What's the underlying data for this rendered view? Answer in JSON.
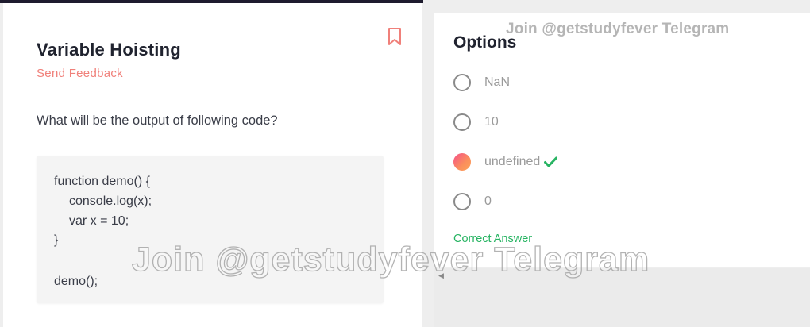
{
  "question": {
    "title": "Variable Hoisting",
    "feedback_label": "Send Feedback",
    "bookmark_icon": "bookmark-icon",
    "text": "What will be the output of following code?",
    "code_lines": [
      "function demo() {",
      "console.log(x);",
      "var x = 10;",
      "}",
      "demo();"
    ]
  },
  "options_panel": {
    "title": "Options",
    "options": [
      {
        "label": "NaN",
        "selected": false
      },
      {
        "label": "10",
        "selected": false
      },
      {
        "label": "undefined",
        "selected": true,
        "correct": true
      },
      {
        "label": "0",
        "selected": false
      }
    ],
    "result_label": "Correct Answer"
  },
  "watermarks": {
    "top": "Join @getstudyfever Telegram",
    "center": "Join @getstudyfever Telegram"
  },
  "colors": {
    "accent": "#f0807a",
    "correct": "#28b463",
    "title": "#20232f"
  }
}
